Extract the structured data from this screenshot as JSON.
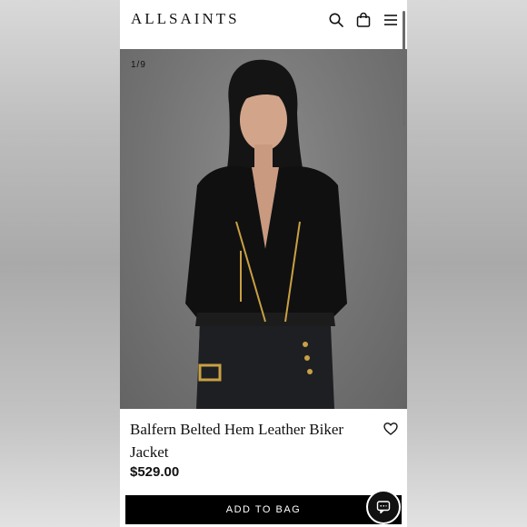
{
  "brand": {
    "logo": "ALLSAINTS"
  },
  "header_icons": [
    "search-icon",
    "bag-icon",
    "menu-icon"
  ],
  "gallery": {
    "counter": "1/9"
  },
  "product": {
    "title": "Balfern Belted Hem Leather Biker Jacket",
    "price": "$529.00"
  },
  "actions": {
    "add_to_bag": "ADD TO BAG"
  },
  "colors": {
    "accent": "#000000",
    "background": "#ffffff"
  }
}
